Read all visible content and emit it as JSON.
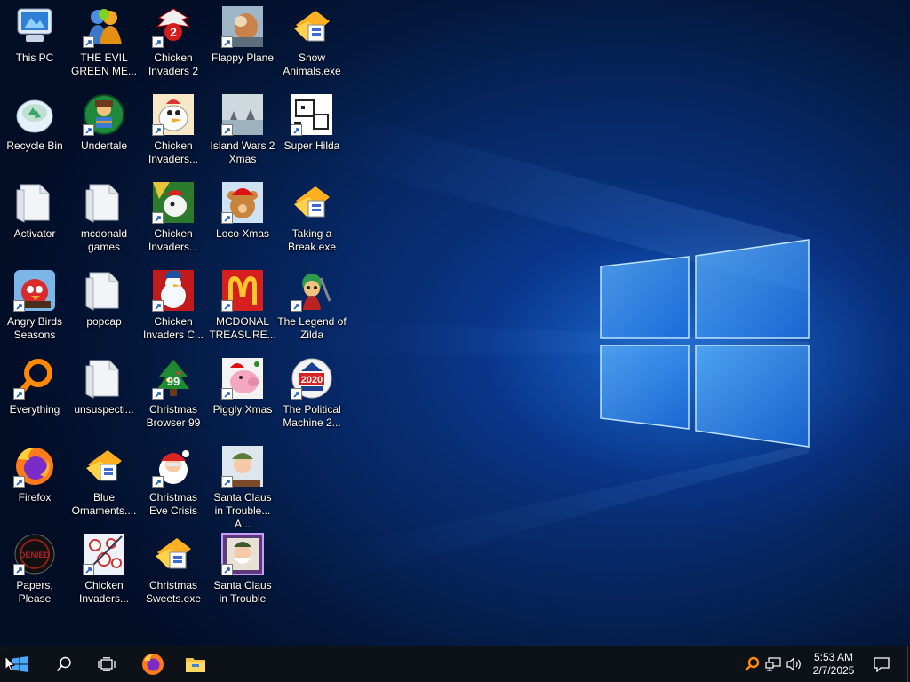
{
  "desktop": {
    "icons": [
      {
        "id": "this-pc",
        "label": "This PC",
        "icon": "this-pc-icon",
        "shortcut": false
      },
      {
        "id": "the-evil-green-me",
        "label": "THE EVIL GREEN ME...",
        "icon": "messenger-people-icon",
        "shortcut": true
      },
      {
        "id": "chicken-invaders-2",
        "label": "Chicken Invaders 2",
        "icon": "chicken-invaders-2-icon",
        "shortcut": true
      },
      {
        "id": "flappy-plane",
        "label": "Flappy Plane",
        "icon": "flappy-plane-icon",
        "shortcut": true
      },
      {
        "id": "snow-animals",
        "label": "Snow Animals.exe",
        "icon": "exe-box-icon",
        "shortcut": false
      },
      {
        "id": "recycle-bin",
        "label": "Recycle Bin",
        "icon": "recycle-bin-icon",
        "shortcut": false
      },
      {
        "id": "undertale",
        "label": "Undertale",
        "icon": "undertale-icon",
        "shortcut": true
      },
      {
        "id": "chicken-invaders-b",
        "label": "Chicken Invaders...",
        "icon": "chicken-invaders-icon",
        "shortcut": true
      },
      {
        "id": "island-wars-2-xmas",
        "label": "Island Wars 2 Xmas",
        "icon": "island-wars-icon",
        "shortcut": true
      },
      {
        "id": "super-hilda",
        "label": "Super Hilda",
        "icon": "super-hilda-icon",
        "shortcut": true
      },
      {
        "id": "activator",
        "label": "Activator",
        "icon": "folder-icon",
        "shortcut": false
      },
      {
        "id": "mcdonald-games",
        "label": "mcdonald games",
        "icon": "folder-icon",
        "shortcut": false
      },
      {
        "id": "chicken-invaders-c",
        "label": "Chicken Invaders...",
        "icon": "chicken-invaders-xmas-icon",
        "shortcut": true
      },
      {
        "id": "loco-xmas",
        "label": "Loco Xmas",
        "icon": "teddy-bear-icon",
        "shortcut": true
      },
      {
        "id": "taking-a-break",
        "label": "Taking a Break.exe",
        "icon": "exe-box-icon",
        "shortcut": false
      },
      {
        "id": "angry-birds-seasons",
        "label": "Angry Birds Seasons",
        "icon": "angry-birds-icon",
        "shortcut": true
      },
      {
        "id": "popcap",
        "label": "popcap",
        "icon": "folder-icon",
        "shortcut": false
      },
      {
        "id": "chicken-invaders-christmas",
        "label": "Chicken Invaders C...",
        "icon": "snowman-icon",
        "shortcut": true
      },
      {
        "id": "mcdonal-treasure",
        "label": "MCDONAL TREASURE...",
        "icon": "mcdonalds-icon",
        "shortcut": true
      },
      {
        "id": "legend-of-zilda",
        "label": "The Legend of Zilda",
        "icon": "zilda-icon",
        "shortcut": true
      },
      {
        "id": "everything",
        "label": "Everything",
        "icon": "everything-search-icon",
        "shortcut": true
      },
      {
        "id": "unsuspecti",
        "label": "unsuspecti...",
        "icon": "folder-icon",
        "shortcut": false
      },
      {
        "id": "christmas-browser-99",
        "label": "Christmas Browser 99",
        "icon": "christmas-tree-icon",
        "shortcut": true
      },
      {
        "id": "piggly-xmas",
        "label": "Piggly Xmas",
        "icon": "pig-icon",
        "shortcut": true
      },
      {
        "id": "political-machine",
        "label": "The Political Machine 2...",
        "icon": "political-machine-icon",
        "shortcut": true
      },
      {
        "id": "firefox",
        "label": "Firefox",
        "icon": "firefox-icon",
        "shortcut": true
      },
      {
        "id": "blue-ornaments",
        "label": "Blue Ornaments....",
        "icon": "exe-box-icon",
        "shortcut": false
      },
      {
        "id": "christmas-eve-crisis",
        "label": "Christmas Eve Crisis",
        "icon": "santa-face-icon",
        "shortcut": true
      },
      {
        "id": "santa-claus-in-trouble-a",
        "label": "Santa Claus in Trouble... A...",
        "icon": "santa-claus-icon",
        "shortcut": true
      },
      {
        "id": "papers-please",
        "label": "Papers, Please",
        "icon": "papers-please-icon",
        "shortcut": true
      },
      {
        "id": "chicken-invaders-d",
        "label": "Chicken Invaders...",
        "icon": "chicken-invaders-eggs-icon",
        "shortcut": true
      },
      {
        "id": "christmas-sweets",
        "label": "Christmas Sweets.exe",
        "icon": "exe-box-icon",
        "shortcut": false
      },
      {
        "id": "santa-claus-in-trouble",
        "label": "Santa Claus in Trouble",
        "icon": "santa-claus-framed-icon",
        "shortcut": true
      }
    ]
  },
  "taskbar": {
    "start": {
      "icon": "windows-start-icon"
    },
    "search": {
      "icon": "search-icon"
    },
    "task_view": {
      "icon": "task-view-icon"
    },
    "pinned": [
      {
        "id": "firefox",
        "icon": "firefox-icon"
      },
      {
        "id": "file-explorer",
        "icon": "file-explorer-icon"
      }
    ],
    "tray": {
      "everything_icon": "everything-search-icon",
      "network_icon": "network-icon",
      "volume_icon": "volume-icon",
      "time": "5:53 AM",
      "date": "2/7/2025",
      "notification_icon": "action-center-icon"
    }
  },
  "colors": {
    "taskbar": "#0d1118",
    "wallpaper_glow": "#2e8cff",
    "label_text": "#ffffff"
  }
}
